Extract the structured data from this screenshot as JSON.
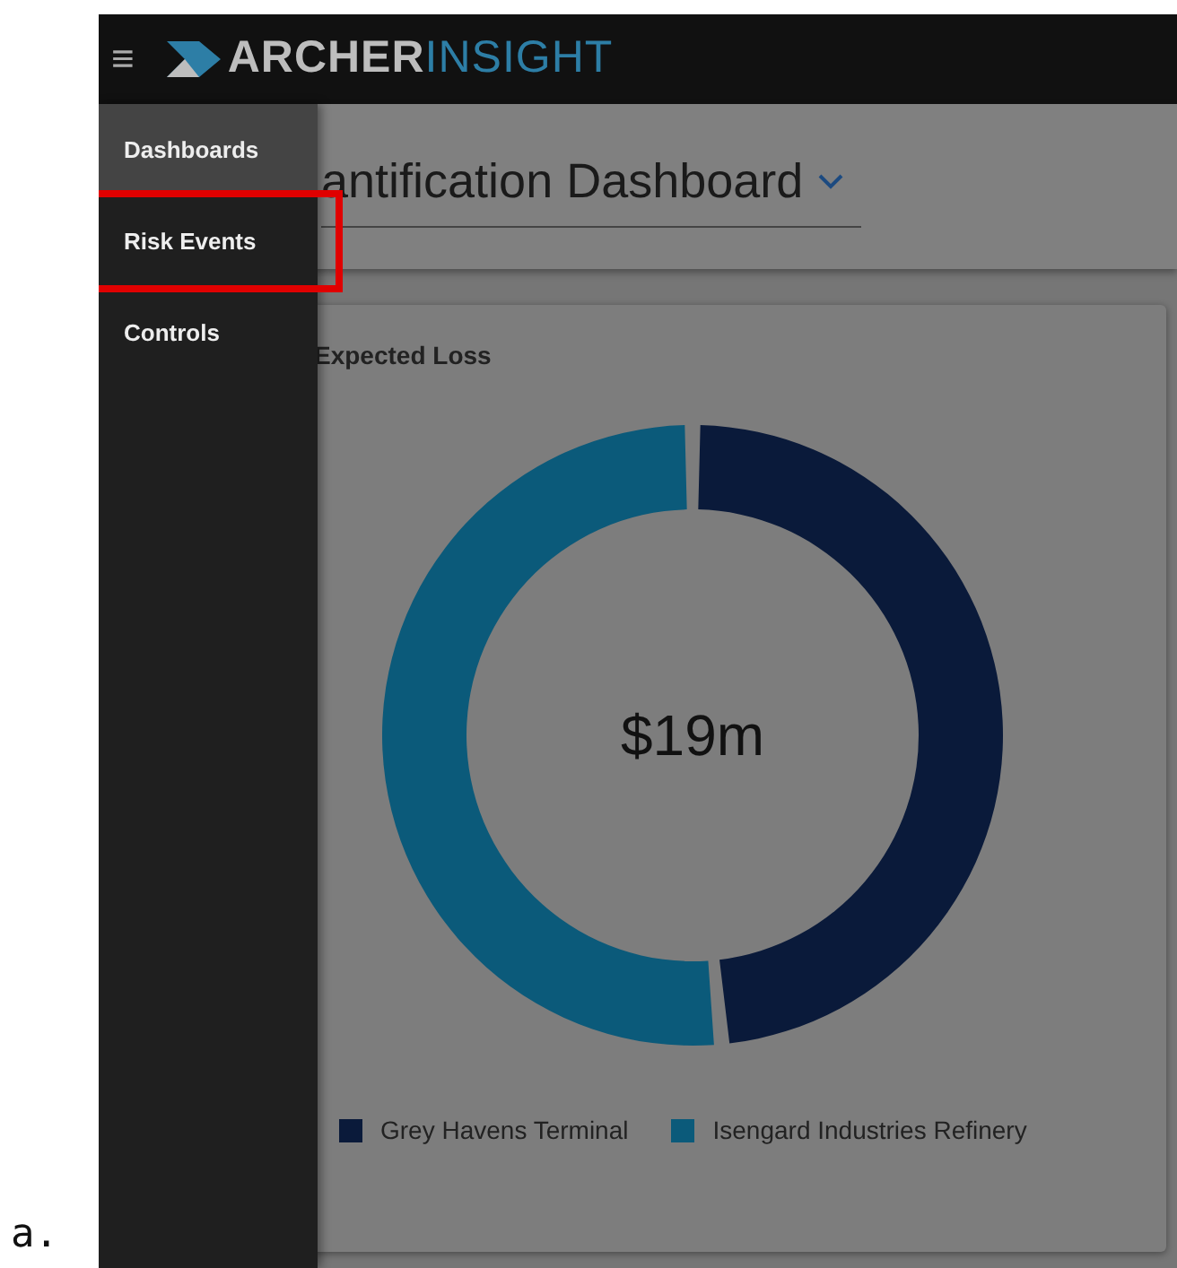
{
  "figure_label": "a.",
  "top_bar": {
    "menu_glyph": "≡",
    "brand_primary": "ARCHER",
    "brand_accent": "INSIGHT"
  },
  "sidebar": {
    "items": [
      {
        "label": "Dashboards",
        "selected": true,
        "annotated": false
      },
      {
        "label": "Risk Events",
        "selected": false,
        "annotated": true
      },
      {
        "label": "Controls",
        "selected": false,
        "annotated": false
      }
    ]
  },
  "page_header": {
    "title": "antification Dashboard"
  },
  "card": {
    "title": "Expected Loss",
    "center_value": "$19m",
    "legend": [
      {
        "label": "Grey Havens Terminal",
        "color": "#0a1a3a"
      },
      {
        "label": "Isengard Industries Refinery",
        "color": "#0b5a7a"
      }
    ]
  }
}
